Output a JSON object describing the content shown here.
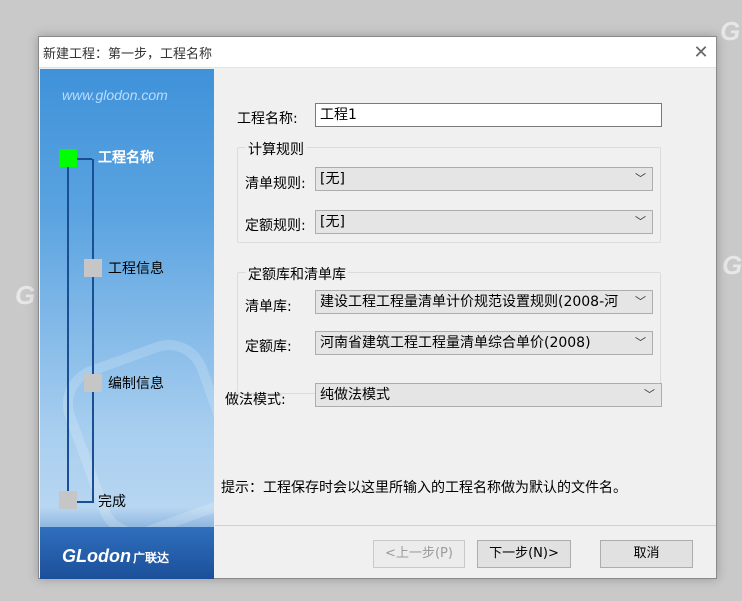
{
  "watermark": "G",
  "dialog": {
    "title": "新建工程：第一步，工程名称",
    "close_glyph": "✕"
  },
  "sidebar": {
    "site": "www.glodon.com",
    "steps": [
      {
        "label": "工程名称",
        "active": true
      },
      {
        "label": "工程信息",
        "active": false
      },
      {
        "label": "编制信息",
        "active": false
      },
      {
        "label": "完成",
        "active": false
      }
    ],
    "logo": "GLodon",
    "logo_cn": "广联达"
  },
  "form": {
    "project_name_label": "工程名称:",
    "project_name_value": "工程1",
    "calc_group_title": "计算规则",
    "bill_rule_label": "清单规则:",
    "bill_rule_value": "[无]",
    "quota_rule_label": "定额规则:",
    "quota_rule_value": "[无]",
    "lib_group_title": "定额库和清单库",
    "bill_lib_label": "清单库:",
    "bill_lib_value": "建设工程工程量清单计价规范设置规则(2008-河",
    "quota_lib_label": "定额库:",
    "quota_lib_value": "河南省建筑工程工程量清单综合单价(2008)",
    "method_label": "做法模式:",
    "method_value": "纯做法模式",
    "hint": "提示：工程保存时会以这里所输入的工程名称做为默认的文件名。"
  },
  "buttons": {
    "prev": "<上一步(P)",
    "next": "下一步(N)>",
    "cancel": "取消"
  },
  "icons": {
    "dropdown": "chevron-down-icon"
  }
}
